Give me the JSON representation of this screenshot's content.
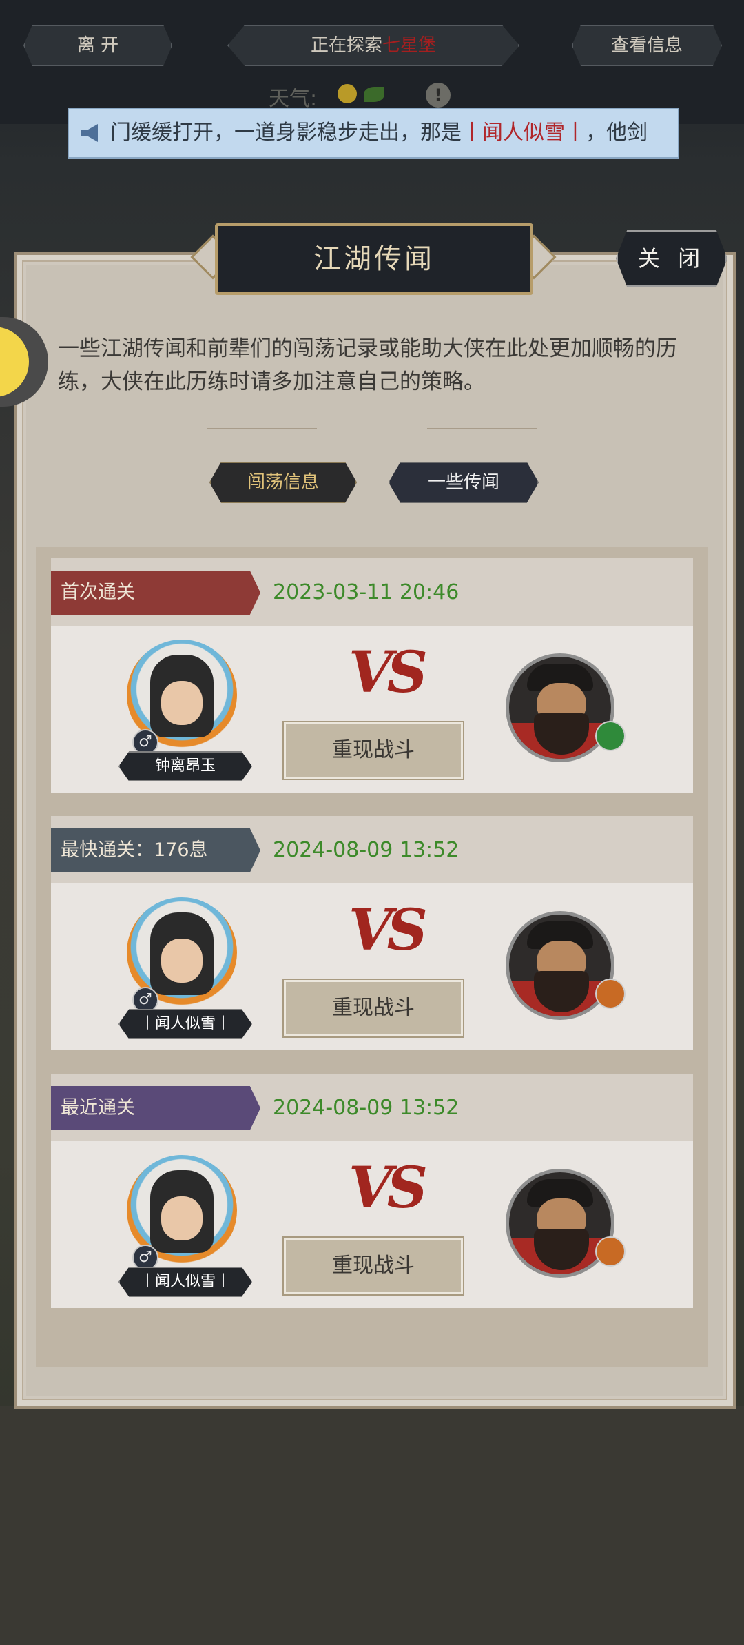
{
  "topbar": {
    "leave_label": "离 开",
    "exploring_prefix": "正在探索",
    "exploring_place": "七星堡",
    "view_info_label": "查看信息",
    "weather_label": "天气:"
  },
  "marquee": {
    "text_before": "门缓缓打开，一道身影稳步走出，那是",
    "name": "丨闻人似雪丨",
    "text_after": "，他剑"
  },
  "dialog": {
    "title": "江湖传闻",
    "close_label": "关 闭",
    "intro": "一些江湖传闻和前辈们的闯荡记录或能助大侠在此处更加顺畅的历练，大侠在此历练时请多加注意自己的策略。",
    "tabs": [
      "闯荡信息",
      "一些传闻"
    ]
  },
  "records": [
    {
      "label": "首次通关",
      "date": "2023-03-11 20:46",
      "ribbon_color": "#8e3a36",
      "hero_name": "钟离昂玉",
      "gender_symbol": "♂",
      "vs_text": "VS",
      "replay_label": "重现战斗",
      "badge_color": "#2f8a3a"
    },
    {
      "label": "最快通关：176息",
      "date": "2024-08-09 13:52",
      "ribbon_color": "#4b5660",
      "hero_name": "丨闻人似雪丨",
      "gender_symbol": "♂",
      "vs_text": "VS",
      "replay_label": "重现战斗",
      "badge_color": "#c86a24"
    },
    {
      "label": "最近通关",
      "date": "2024-08-09 13:52",
      "ribbon_color": "#5a4a78",
      "hero_name": "丨闻人似雪丨",
      "gender_symbol": "♂",
      "vs_text": "VS",
      "replay_label": "重现战斗",
      "badge_color": "#c86a24"
    }
  ]
}
